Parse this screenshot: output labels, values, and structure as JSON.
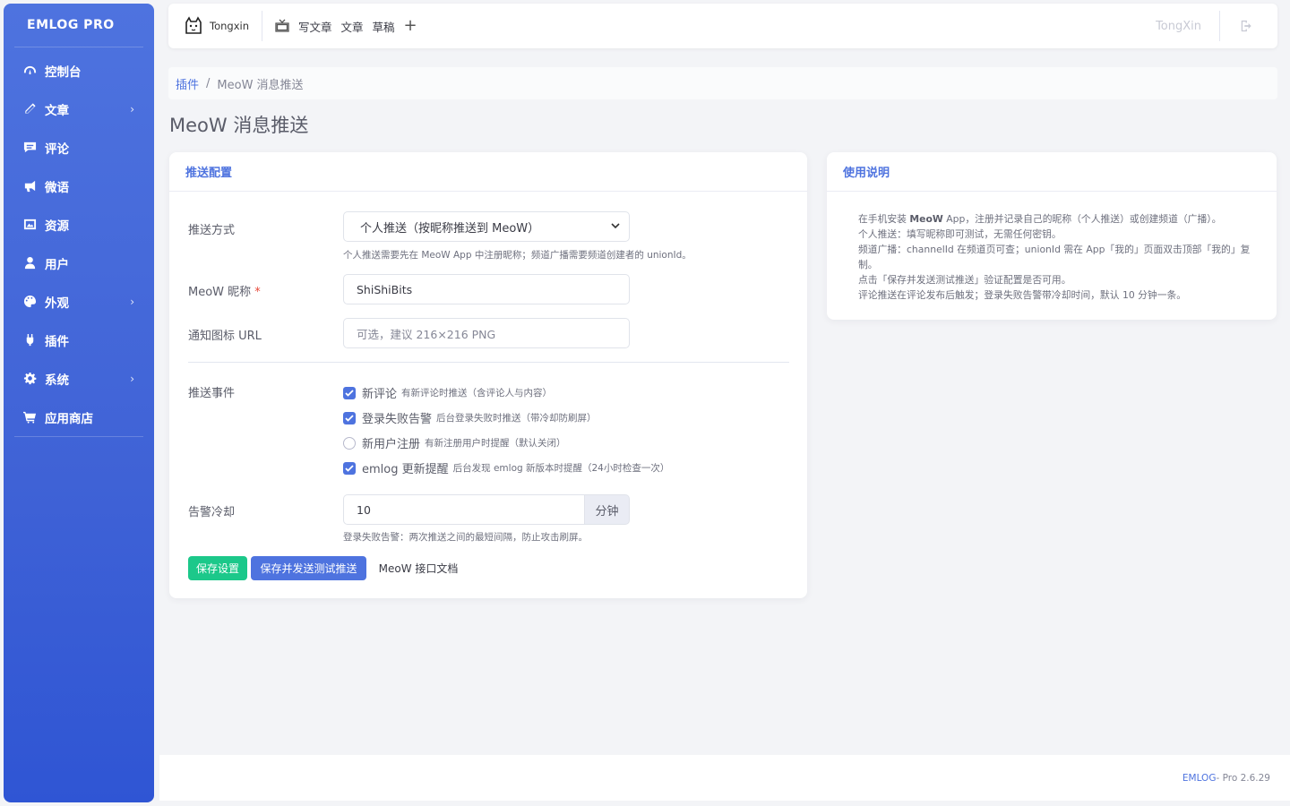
{
  "sidebar": {
    "brand": "EMLOG PRO",
    "items": [
      {
        "label": "控制台",
        "icon": "dashboard-icon",
        "has_submenu": false
      },
      {
        "label": "文章",
        "icon": "pencil-icon",
        "has_submenu": true
      },
      {
        "label": "评论",
        "icon": "comment-icon",
        "has_submenu": false
      },
      {
        "label": "微语",
        "icon": "bullhorn-icon",
        "has_submenu": false
      },
      {
        "label": "资源",
        "icon": "image-icon",
        "has_submenu": false
      },
      {
        "label": "用户",
        "icon": "user-icon",
        "has_submenu": false
      },
      {
        "label": "外观",
        "icon": "palette-icon",
        "has_submenu": true
      },
      {
        "label": "插件",
        "icon": "plug-icon",
        "has_submenu": false
      },
      {
        "label": "系统",
        "icon": "gear-icon",
        "has_submenu": true
      },
      {
        "label": "应用商店",
        "icon": "cart-icon",
        "has_submenu": false
      }
    ],
    "chevron": "›"
  },
  "topbar": {
    "site_name": "Tongxin",
    "links": [
      "写文章",
      "文章",
      "草稿"
    ],
    "plus": "+",
    "user": "TongXin"
  },
  "breadcrumb": {
    "parent": "插件",
    "separator": "/",
    "current": "MeoW 消息推送"
  },
  "page_title": "MeoW 消息推送",
  "config_card": {
    "header": "推送配置",
    "push_mode": {
      "label": "推送方式",
      "selected": "个人推送（按昵称推送到 MeoW）",
      "help": "个人推送需要先在 MeoW App 中注册昵称；频道广播需要频道创建者的 unionId。"
    },
    "nickname": {
      "label": "MeoW 昵称",
      "required_mark": "*",
      "value": "ShiShiBits"
    },
    "icon_url": {
      "label": "通知图标 URL",
      "placeholder": "可选，建议 216×216 PNG"
    },
    "events": {
      "label": "推送事件",
      "items": [
        {
          "title": "新评论",
          "desc": "有新评论时推送（含评论人与内容）",
          "checked": true
        },
        {
          "title": "登录失败告警",
          "desc": "后台登录失败时推送（带冷却防刷屏）",
          "checked": true
        },
        {
          "title": "新用户注册",
          "desc": "有新注册用户时提醒（默认关闭）",
          "checked": false
        },
        {
          "title": "emlog 更新提醒",
          "desc": "后台发现 emlog 新版本时提醒（24小时检查一次）",
          "checked": true
        }
      ]
    },
    "cooldown": {
      "label": "告警冷却",
      "value": "10",
      "unit": "分钟",
      "help": "登录失败告警：两次推送之间的最短间隔，防止攻击刷屏。"
    },
    "buttons": {
      "save": "保存设置",
      "save_test": "保存并发送测试推送",
      "docs": "MeoW 接口文档"
    }
  },
  "help_card": {
    "header": "使用说明",
    "line1_pre": "在手机安装 ",
    "line1_bold": "MeoW",
    "line1_post": " App，注册并记录自己的昵称（个人推送）或创建频道（广播）。",
    "line2": "个人推送：填写昵称即可测试，无需任何密钥。",
    "line3": "频道广播：channelId 在频道页可查；unionId 需在 App「我的」页面双击顶部「我的」复制。",
    "line4": "点击「保存并发送测试推送」验证配置是否可用。",
    "line5": "评论推送在评论发布后触发；登录失败告警带冷却时间，默认 10 分钟一条。"
  },
  "footer": {
    "brand": "EMLOG",
    "version": " - Pro 2.6.29"
  },
  "colors": {
    "primary": "#4e73df",
    "success": "#1cc88a",
    "danger": "#e74a3b"
  }
}
